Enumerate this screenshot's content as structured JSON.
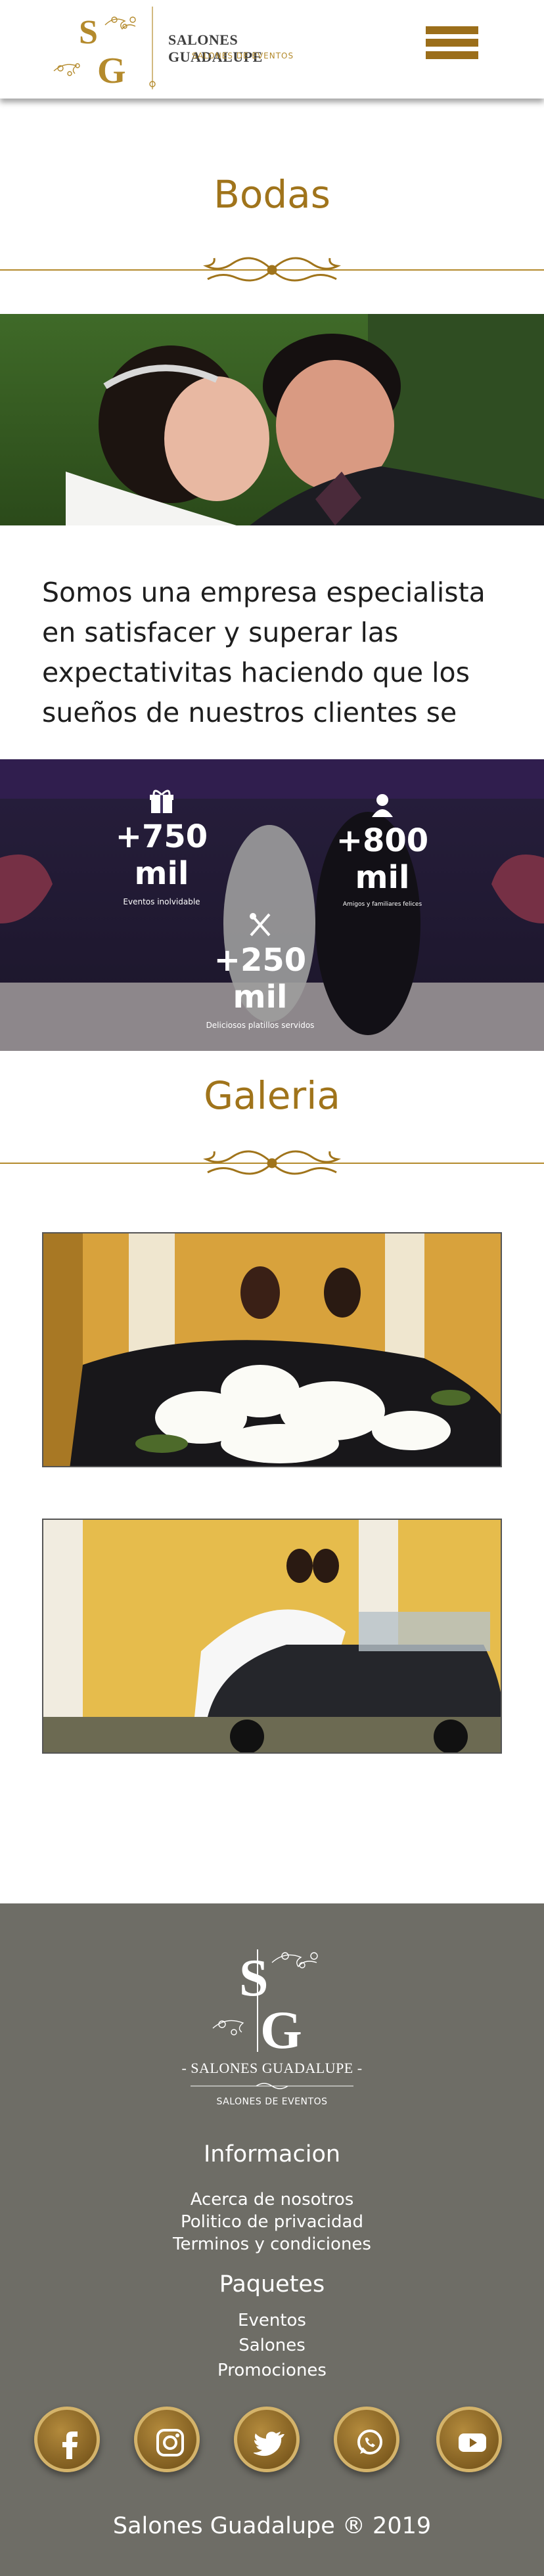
{
  "header": {
    "brand_name": "SALONES GUADALUPE",
    "brand_sub": "SALONES DE EVENTOS",
    "menu_icon": "hamburger-menu-icon"
  },
  "sections": {
    "bodas_title": "Bodas",
    "intro_text": "Somos una empresa especialista en satisfacer y superar las expectativitas haciendo que los sueños de nuestros clientes se",
    "galeria_title": "Galeria"
  },
  "stats": [
    {
      "value": "+750 mil",
      "caption": "Eventos inolvidable",
      "icon": "gift-icon"
    },
    {
      "value": "+800 mil",
      "caption": "Amigos y familiares felices",
      "icon": "user-icon"
    },
    {
      "value": "+250 mil",
      "caption": "Deliciosos platillos servidos",
      "icon": "utensils-icon"
    }
  ],
  "footer": {
    "brand_name": "- SALONES GUADALUPE -",
    "brand_sub": "SALONES DE EVENTOS",
    "info_title": "Informacion",
    "info_links": [
      "Acerca de nosotros",
      "Politico de privacidad",
      "Terminos y condiciones"
    ],
    "packages_title": "Paquetes",
    "package_links": [
      "Eventos",
      "Salones",
      "Promociones"
    ],
    "social": [
      "facebook-icon",
      "instagram-icon",
      "twitter-icon",
      "whatsapp-icon",
      "youtube-icon"
    ],
    "copyright": "Salones Guadalupe ® 2019"
  },
  "colors": {
    "gold": "#a0741b",
    "footer_bg": "#6e6d66",
    "menu": "#9b6e1a"
  }
}
